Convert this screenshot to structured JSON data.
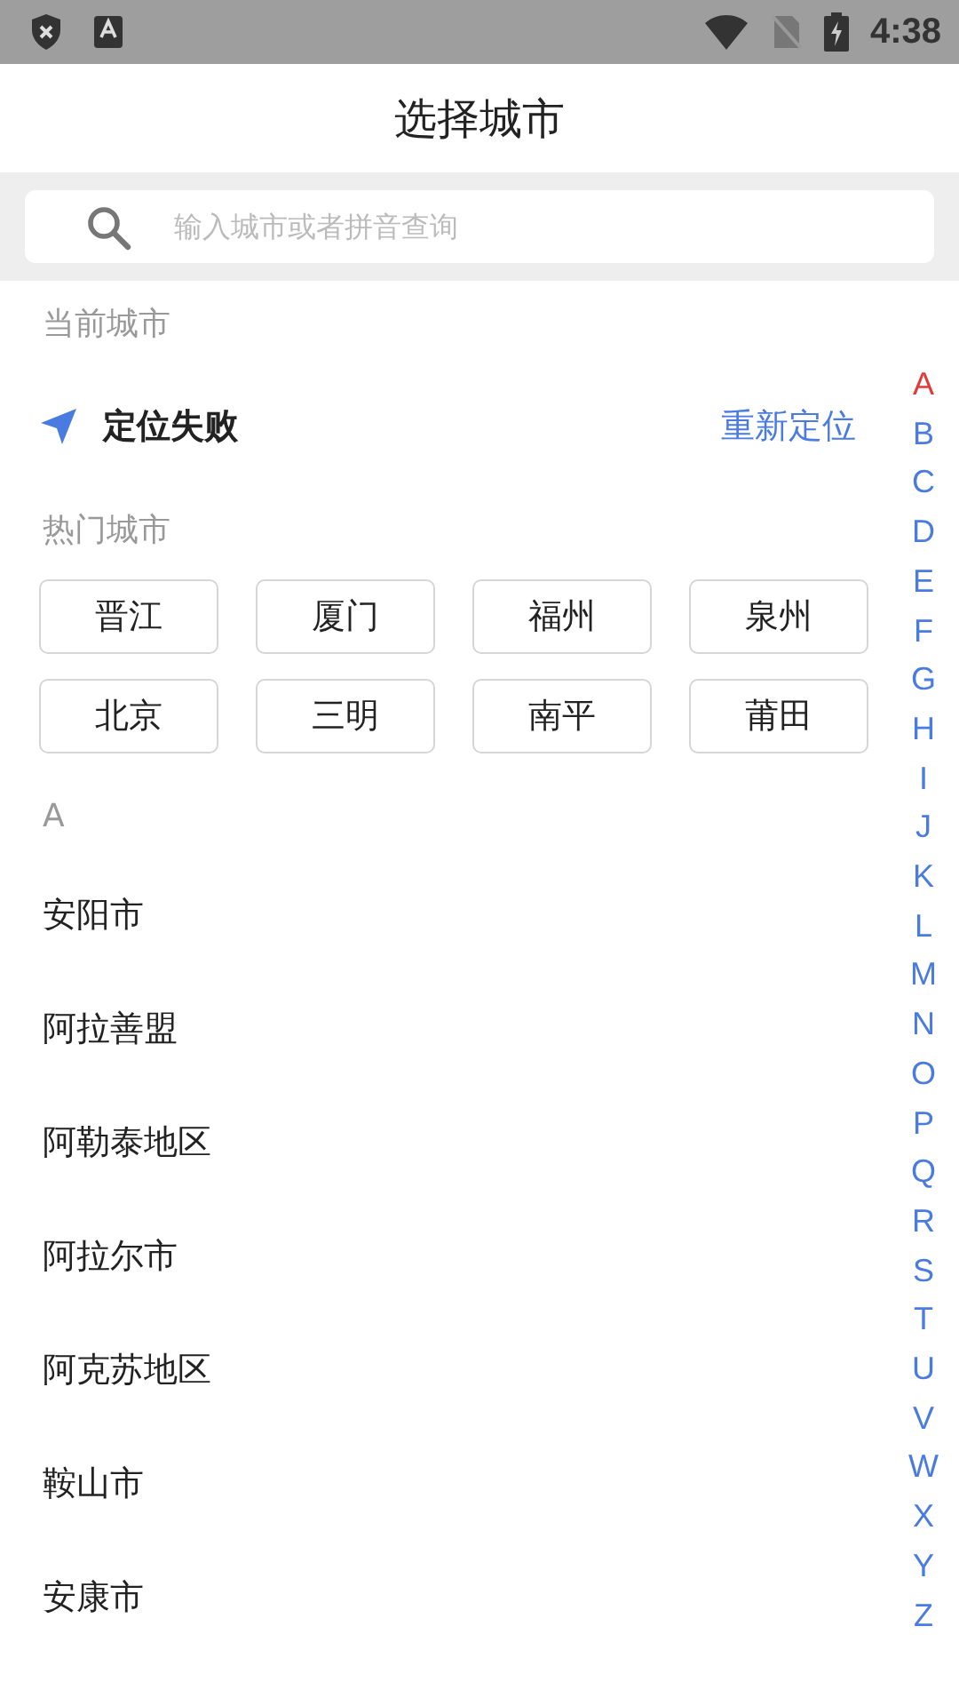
{
  "status_bar": {
    "time": "4:38"
  },
  "title": "选择城市",
  "search": {
    "placeholder": "输入城市或者拼音查询"
  },
  "current_city": {
    "label": "当前城市",
    "status": "定位失败",
    "action": "重新定位"
  },
  "hot_cities": {
    "label": "热门城市",
    "items": [
      "晋江",
      "厦门",
      "福州",
      "泉州",
      "北京",
      "三明",
      "南平",
      "莆田"
    ]
  },
  "city_groups": [
    {
      "letter": "A",
      "cities": [
        "安阳市",
        "阿拉善盟",
        "阿勒泰地区",
        "阿拉尔市",
        "阿克苏地区",
        "鞍山市",
        "安康市"
      ]
    }
  ],
  "index": [
    {
      "letter": "A",
      "selected": true
    },
    {
      "letter": "B",
      "selected": false
    },
    {
      "letter": "C",
      "selected": false
    },
    {
      "letter": "D",
      "selected": false
    },
    {
      "letter": "E",
      "selected": false
    },
    {
      "letter": "F",
      "selected": false
    },
    {
      "letter": "G",
      "selected": false
    },
    {
      "letter": "H",
      "selected": false
    },
    {
      "letter": "I",
      "selected": false
    },
    {
      "letter": "J",
      "selected": false
    },
    {
      "letter": "K",
      "selected": false
    },
    {
      "letter": "L",
      "selected": false
    },
    {
      "letter": "M",
      "selected": false
    },
    {
      "letter": "N",
      "selected": false
    },
    {
      "letter": "O",
      "selected": false
    },
    {
      "letter": "P",
      "selected": false
    },
    {
      "letter": "Q",
      "selected": false
    },
    {
      "letter": "R",
      "selected": false
    },
    {
      "letter": "S",
      "selected": false
    },
    {
      "letter": "T",
      "selected": false
    },
    {
      "letter": "U",
      "selected": false
    },
    {
      "letter": "V",
      "selected": false
    },
    {
      "letter": "W",
      "selected": false
    },
    {
      "letter": "X",
      "selected": false
    },
    {
      "letter": "Y",
      "selected": false
    },
    {
      "letter": "Z",
      "selected": false
    }
  ]
}
